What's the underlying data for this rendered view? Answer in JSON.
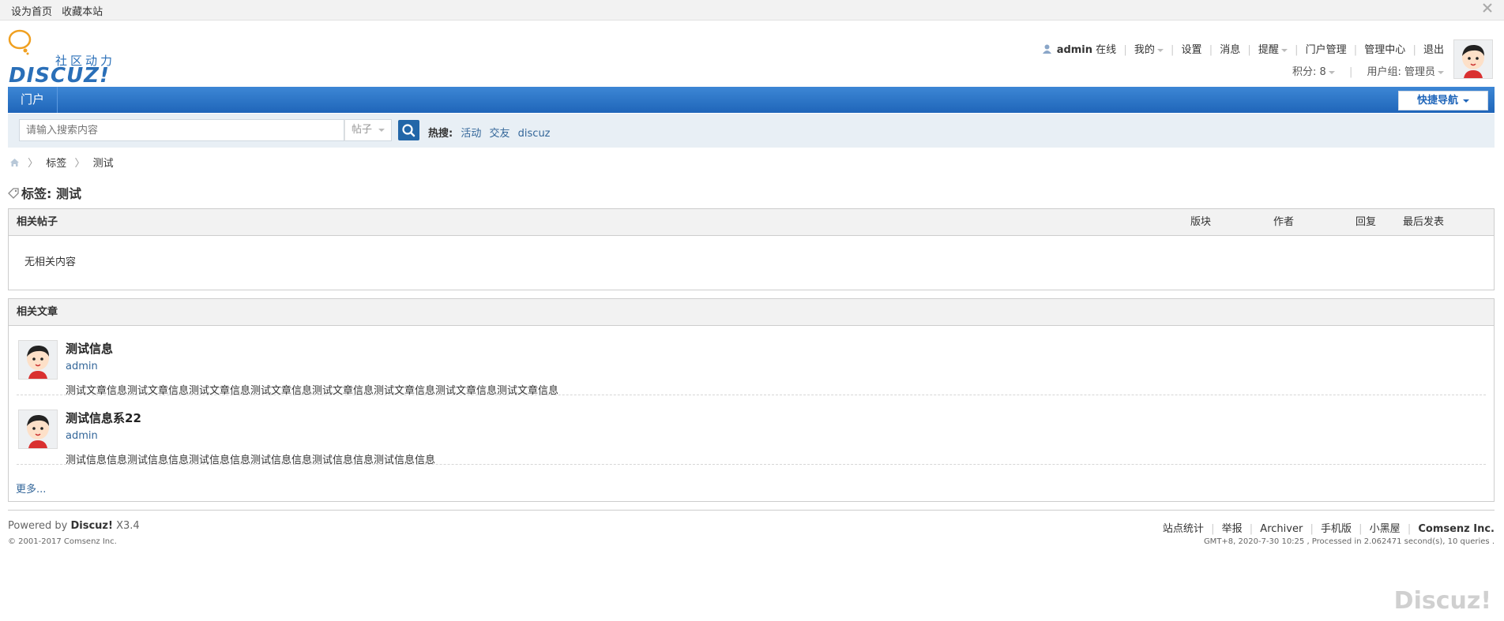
{
  "toptb": {
    "links": [
      "设为首页",
      "收藏本站"
    ]
  },
  "logo": {
    "tagline": "社区动力",
    "word": "DISCUZ!"
  },
  "user_menu": {
    "username": "admin",
    "status": "在线",
    "items": [
      "我的",
      "设置",
      "消息",
      "提醒",
      "门户管理",
      "管理中心",
      "退出"
    ],
    "credits": "积分: 8",
    "group": "用户组: 管理员"
  },
  "nav": {
    "item": "门户",
    "quick_nav": "快捷导航"
  },
  "search": {
    "placeholder": "请输入搜索内容",
    "type": "帖子",
    "hot_label": "热搜:",
    "hot_terms": [
      "活动",
      "交友",
      "discuz"
    ]
  },
  "breadcrumb": [
    "标签",
    "测试"
  ],
  "page_title": "标签: 测试",
  "threads": {
    "header": "相关帖子",
    "columns": [
      "版块",
      "作者",
      "回复",
      "最后发表"
    ],
    "empty_text": "无相关内容"
  },
  "articles": {
    "header": "相关文章",
    "items": [
      {
        "title": "测试信息",
        "author": "admin",
        "summary": "测试文章信息测试文章信息测试文章信息测试文章信息测试文章信息测试文章信息测试文章信息测试文章信息"
      },
      {
        "title": "测试信息系22",
        "author": "admin",
        "summary": "测试信息信息测试信息信息测试信息信息测试信息信息测试信息信息测试信息信息"
      }
    ],
    "more": "更多..."
  },
  "footer": {
    "powered_prefix": "Powered by ",
    "powered_brand": "Discuz!",
    "powered_version": " X3.4",
    "copyright": "© 2001-2017 Comsenz Inc.",
    "links": [
      "站点统计",
      "举报",
      "Archiver",
      "手机版",
      "小黑屋"
    ],
    "company": "Comsenz Inc.",
    "gmt": "GMT+8, 2020-7-30 10:25 , Processed in 2.062471 second(s), 10 queries ."
  },
  "watermark": "Discuz!",
  "colors": {
    "brand": "#2a6fb8",
    "nav_top": "#3d87d5",
    "nav_bottom": "#1f65b9",
    "search_bg": "#e8eff5",
    "link": "#336699"
  }
}
